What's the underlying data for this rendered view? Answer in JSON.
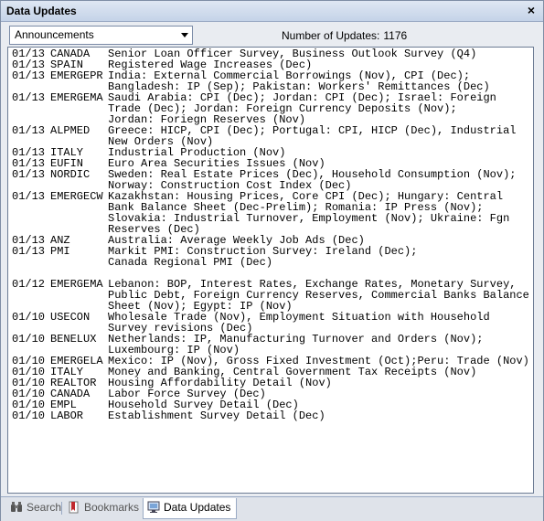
{
  "window": {
    "title": "Data Updates",
    "close_label": "×"
  },
  "toolbar": {
    "dropdown_value": "Announcements",
    "count_label": "Number of Updates:",
    "count_value": "1176"
  },
  "rows": [
    {
      "date": "01/13",
      "source": "CANADA",
      "desc": "Senior Loan Officer Survey, Business Outlook Survey (Q4)"
    },
    {
      "date": "01/13",
      "source": "SPAIN",
      "desc": "Registered Wage Increases (Dec)"
    },
    {
      "date": "01/13",
      "source": "EMERGEPR",
      "desc": "India: External Commercial Borrowings (Nov), CPI (Dec);"
    },
    {
      "date": "",
      "source": "",
      "desc": "Bangladesh: IP (Sep); Pakistan: Workers' Remittances (Dec)"
    },
    {
      "date": "01/13",
      "source": "EMERGEMA",
      "desc": "Saudi Arabia: CPI (Dec); Jordan: CPI (Dec); Israel: Foreign"
    },
    {
      "date": "",
      "source": "",
      "desc": "Trade (Dec); Jordan: Foreign Currency Deposits (Nov);"
    },
    {
      "date": "",
      "source": "",
      "desc": "Jordan: Foriegn Reserves (Nov)"
    },
    {
      "date": "01/13",
      "source": "ALPMED",
      "desc": "Greece: HICP, CPI (Dec); Portugal: CPI, HICP (Dec), Industrial"
    },
    {
      "date": "",
      "source": "",
      "desc": "New Orders (Nov)"
    },
    {
      "date": "01/13",
      "source": "ITALY",
      "desc": "Industrial Production (Nov)"
    },
    {
      "date": "01/13",
      "source": "EUFIN",
      "desc": "Euro Area Securities Issues (Nov)"
    },
    {
      "date": "01/13",
      "source": "NORDIC",
      "desc": "Sweden: Real Estate Prices (Dec), Household Consumption (Nov);"
    },
    {
      "date": "",
      "source": "",
      "desc": "Norway: Construction Cost Index (Dec)"
    },
    {
      "date": "01/13",
      "source": "EMERGECW",
      "desc": "Kazakhstan: Housing Prices, Core CPI (Dec); Hungary: Central"
    },
    {
      "date": "",
      "source": "",
      "desc": "Bank Balance Sheet (Dec-Prelim); Romania: IP Press (Nov);"
    },
    {
      "date": "",
      "source": "",
      "desc": "Slovakia: Industrial Turnover, Employment (Nov); Ukraine: Fgn"
    },
    {
      "date": "",
      "source": "",
      "desc": "Reserves (Dec)"
    },
    {
      "date": "01/13",
      "source": "ANZ",
      "desc": "Australia: Average Weekly Job Ads (Dec)"
    },
    {
      "date": "01/13",
      "source": "PMI",
      "desc": "Markit PMI: Construction Survey: Ireland (Dec);"
    },
    {
      "date": "",
      "source": "",
      "desc": "Canada Regional PMI (Dec)"
    },
    {
      "date": "",
      "source": "",
      "desc": ""
    },
    {
      "date": "01/12",
      "source": "EMERGEMA",
      "desc": "Lebanon: BOP, Interest Rates, Exchange Rates, Monetary Survey,"
    },
    {
      "date": "",
      "source": "",
      "desc": "Public Debt, Foreign Currency Reserves, Commercial Banks Balance"
    },
    {
      "date": "",
      "source": "",
      "desc": "Sheet (Nov); Egypt: IP (Nov)"
    },
    {
      "date": "01/10",
      "source": "USECON",
      "desc": "Wholesale Trade (Nov), Employment Situation with Household"
    },
    {
      "date": "",
      "source": "",
      "desc": "Survey revisions (Dec)"
    },
    {
      "date": "01/10",
      "source": "BENELUX",
      "desc": "Netherlands: IP, Manufacturing Turnover and Orders (Nov);"
    },
    {
      "date": "",
      "source": "",
      "desc": "Luxembourg: IP (Nov)"
    },
    {
      "date": "01/10",
      "source": "EMERGELA",
      "desc": "Mexico: IP (Nov), Gross Fixed Investment (Oct);Peru: Trade (Nov)"
    },
    {
      "date": "01/10",
      "source": "ITALY",
      "desc": "Money and Banking, Central Government Tax Receipts (Nov)"
    },
    {
      "date": "01/10",
      "source": "REALTOR",
      "desc": "Housing Affordability Detail (Nov)"
    },
    {
      "date": "01/10",
      "source": "CANADA",
      "desc": "Labor Force Survey (Dec)"
    },
    {
      "date": "01/10",
      "source": "EMPL",
      "desc": "Household Survey Detail (Dec)"
    },
    {
      "date": "01/10",
      "source": "LABOR",
      "desc": "Establishment Survey Detail (Dec)"
    }
  ],
  "tabs": [
    {
      "label": "Search",
      "icon": "binoculars-icon"
    },
    {
      "label": "Bookmarks",
      "icon": "bookmark-icon"
    },
    {
      "label": "Data Updates",
      "icon": "monitor-icon"
    }
  ],
  "colors": {
    "accent": "#c4d3e8",
    "active_tab": "#ffffff",
    "bookmark_red": "#c0282d"
  }
}
